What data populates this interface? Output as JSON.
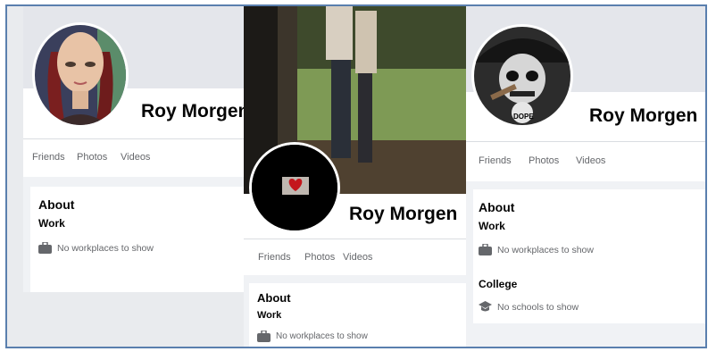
{
  "profiles": [
    {
      "name": "Roy Morgen",
      "tabs": [
        "Friends",
        "Photos",
        "Videos"
      ],
      "about": {
        "title": "About",
        "work_label": "Work",
        "work_text": "No workplaces to show"
      }
    },
    {
      "name": "Roy Morgen",
      "tabs": [
        "Friends",
        "Photos",
        "Videos"
      ],
      "about": {
        "title": "About",
        "work_label": "Work",
        "work_text": "No workplaces to show"
      }
    },
    {
      "name": "Roy Morgen",
      "avatar_badge": "DOPE",
      "tabs": [
        "Friends",
        "Photos",
        "Videos"
      ],
      "about": {
        "title": "About",
        "work_label": "Work",
        "work_text": "No workplaces to show",
        "college_label": "College",
        "college_text": "No schools to show"
      }
    }
  ],
  "colors": {
    "frame_border": "#5a7fae",
    "page_bg": "#f0f2f5",
    "secondary_text": "#65676b"
  }
}
